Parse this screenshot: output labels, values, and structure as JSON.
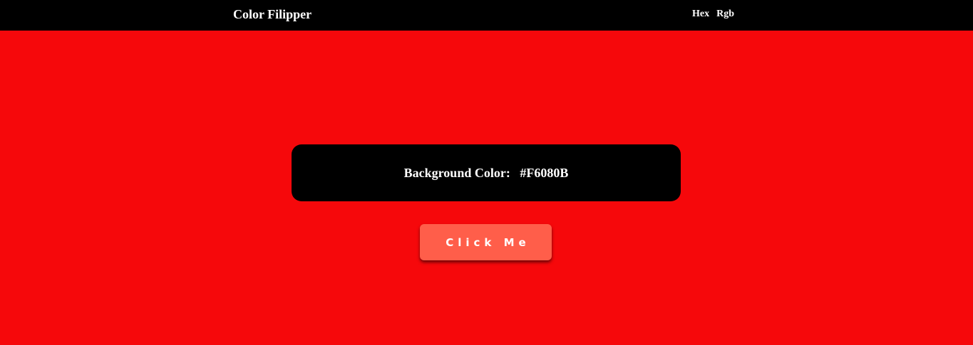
{
  "navbar": {
    "brand": "Color Filipper",
    "links": [
      "Hex",
      "Rgb"
    ]
  },
  "panel": {
    "label": "Background Color:",
    "value": "#F6080B"
  },
  "button": {
    "label": "Click Me"
  },
  "colors": {
    "background": "#F6080B",
    "navbar": "#000000",
    "panel": "#000000",
    "button": "#FF5E4A"
  }
}
